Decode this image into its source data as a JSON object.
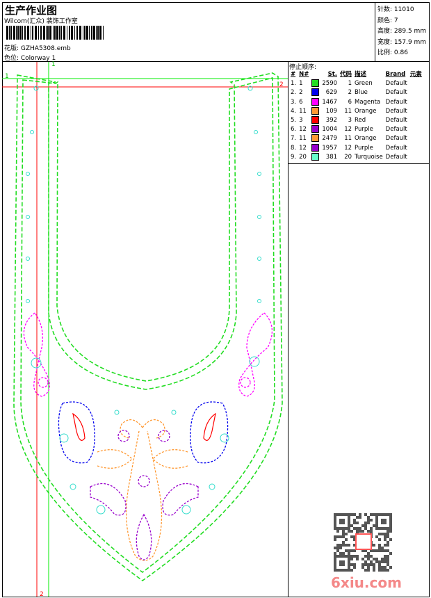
{
  "header": {
    "title": "生产作业图",
    "company": "Wilcom(汇众) 装饰工作室",
    "design_file": "花版: GZHA5308.emb",
    "colorway": "色位: Colorway 1"
  },
  "stats": [
    {
      "label": "针数",
      "value": "11010"
    },
    {
      "label": "颜色",
      "value": "7"
    },
    {
      "label": "高度",
      "value": "289.5 mm"
    },
    {
      "label": "宽度",
      "value": "157.9 mm"
    },
    {
      "label": "比例",
      "value": "0.86"
    }
  ],
  "stop_sequence": {
    "title": "停止顺序:",
    "columns": [
      "#",
      "N#",
      "",
      "St.",
      "代码",
      "描述",
      "Brand",
      "元素"
    ],
    "rows": [
      {
        "idx": "1.",
        "n": "1",
        "color": "#22dd22",
        "st": "2590",
        "code": "1",
        "desc": "Green",
        "brand": "Default"
      },
      {
        "idx": "2.",
        "n": "2",
        "color": "#0000ee",
        "st": "629",
        "code": "2",
        "desc": "Blue",
        "brand": "Default"
      },
      {
        "idx": "3.",
        "n": "6",
        "color": "#ff00ff",
        "st": "1467",
        "code": "6",
        "desc": "Magenta",
        "brand": "Default"
      },
      {
        "idx": "4.",
        "n": "11",
        "color": "#ff9933",
        "st": "109",
        "code": "11",
        "desc": "Orange",
        "brand": "Default"
      },
      {
        "idx": "5.",
        "n": "3",
        "color": "#ff0000",
        "st": "392",
        "code": "3",
        "desc": "Red",
        "brand": "Default"
      },
      {
        "idx": "6.",
        "n": "12",
        "color": "#9900cc",
        "st": "1004",
        "code": "12",
        "desc": "Purple",
        "brand": "Default"
      },
      {
        "idx": "7.",
        "n": "11",
        "color": "#ff9933",
        "st": "2479",
        "code": "11",
        "desc": "Orange",
        "brand": "Default"
      },
      {
        "idx": "8.",
        "n": "12",
        "color": "#9900cc",
        "st": "1957",
        "code": "12",
        "desc": "Purple",
        "brand": "Default"
      },
      {
        "idx": "9.",
        "n": "20",
        "color": "#66ffcc",
        "st": "381",
        "code": "20",
        "desc": "Turquoise",
        "brand": "Default"
      }
    ]
  },
  "guides": {
    "v_green": "1",
    "h_green": "1",
    "h_red": "2",
    "v_red": "2"
  },
  "watermark": "6xiu.com"
}
